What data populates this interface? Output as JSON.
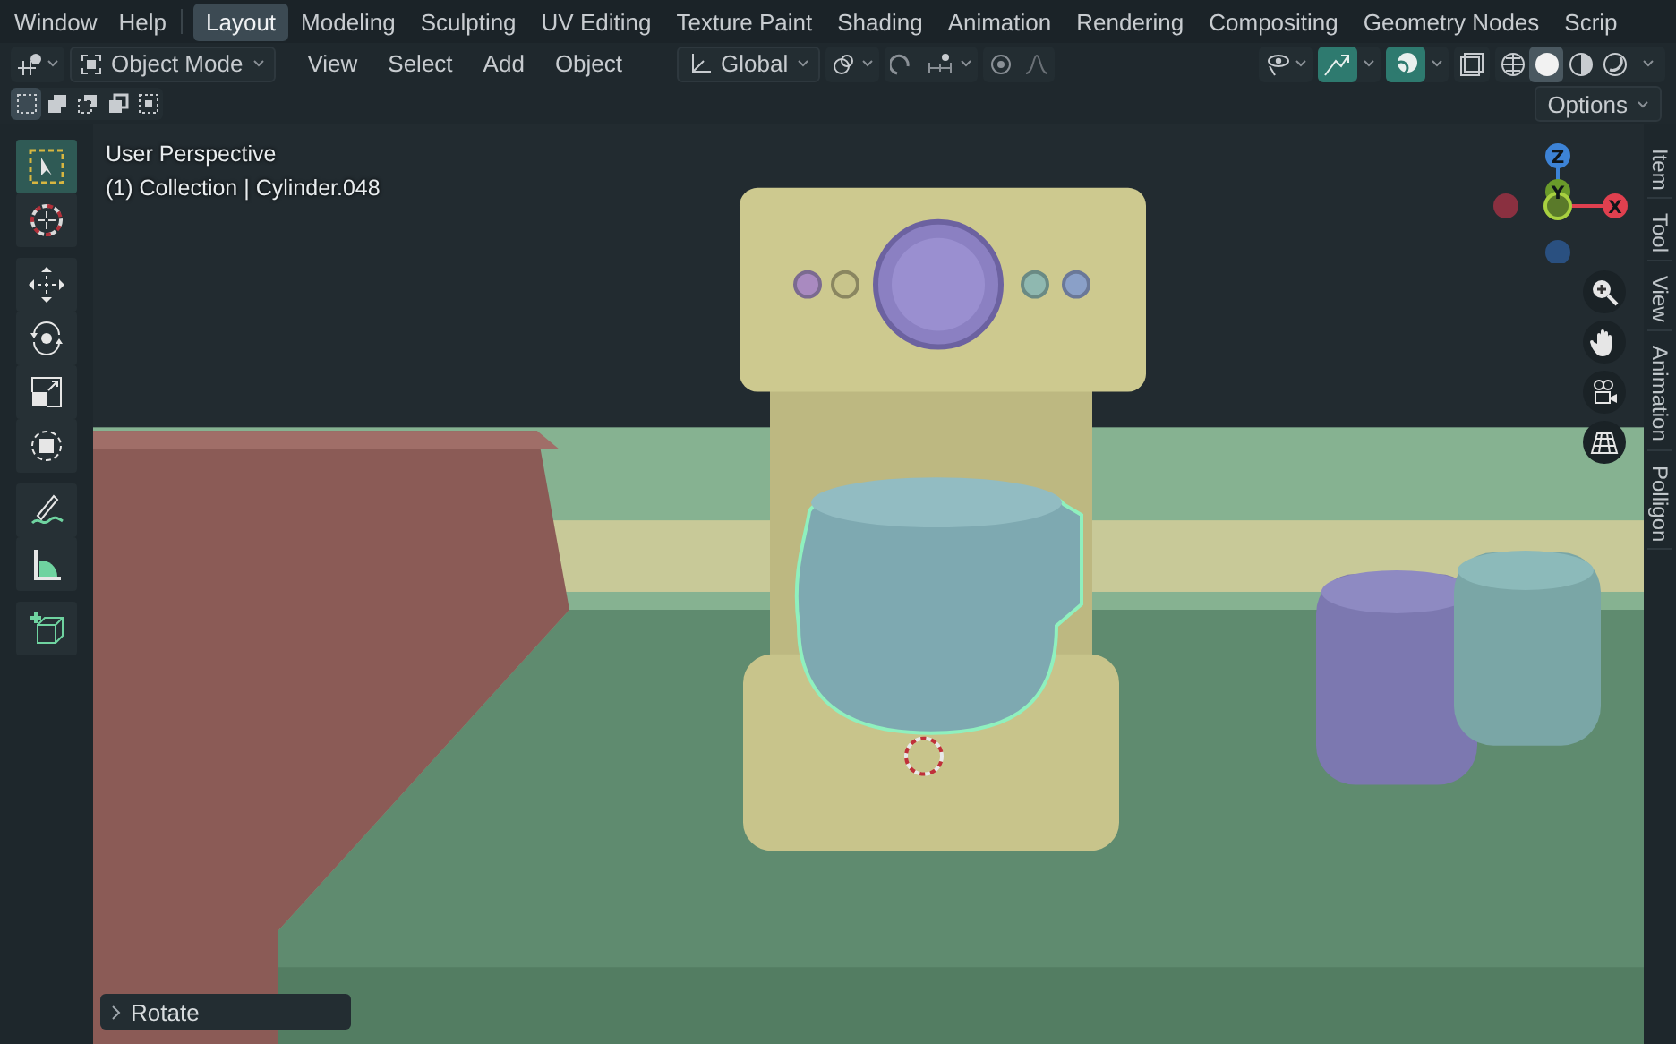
{
  "menu": [
    {
      "label": "Window"
    },
    {
      "label": "Help"
    }
  ],
  "workspaces": [
    {
      "label": "Layout",
      "selected": true
    },
    {
      "label": "Modeling",
      "selected": false
    },
    {
      "label": "Sculpting",
      "selected": false
    },
    {
      "label": "UV Editing",
      "selected": false
    },
    {
      "label": "Texture Paint",
      "selected": false
    },
    {
      "label": "Shading",
      "selected": false
    },
    {
      "label": "Animation",
      "selected": false
    },
    {
      "label": "Rendering",
      "selected": false
    },
    {
      "label": "Compositing",
      "selected": false
    },
    {
      "label": "Geometry Nodes",
      "selected": false
    },
    {
      "label": "Scrip",
      "selected": false
    }
  ],
  "header": {
    "mode": "Object Mode",
    "menus": [
      "View",
      "Select",
      "Add",
      "Object"
    ],
    "orientation": "Global"
  },
  "shading_modes": [
    {
      "kind": "wireframe",
      "selected": false
    },
    {
      "kind": "solid",
      "selected": true
    },
    {
      "kind": "material",
      "selected": false
    },
    {
      "kind": "rendered",
      "selected": false
    }
  ],
  "select_modes": [
    {
      "selected": true
    },
    {
      "selected": false
    },
    {
      "selected": false
    },
    {
      "selected": false
    },
    {
      "selected": false
    }
  ],
  "options_button": "Options",
  "viewport": {
    "view_name": "User Perspective",
    "object_info": "(1) Collection | Cylinder.048"
  },
  "tools": [
    {
      "kind": "select",
      "selected": true
    },
    {
      "kind": "cursor",
      "selected": false
    },
    {
      "kind": "move",
      "selected": false
    },
    {
      "kind": "rotate",
      "selected": false
    },
    {
      "kind": "scale",
      "selected": false
    },
    {
      "kind": "transform",
      "selected": false
    },
    {
      "kind": "annotate",
      "selected": false
    },
    {
      "kind": "measure",
      "selected": false
    },
    {
      "kind": "add_cube",
      "selected": false
    }
  ],
  "gizmo": {
    "z": "Z",
    "y": "Y",
    "x": "X"
  },
  "sidebar_tabs": [
    "Item",
    "Tool",
    "View",
    "Animation",
    "Polligon"
  ],
  "last_operator": "Rotate"
}
